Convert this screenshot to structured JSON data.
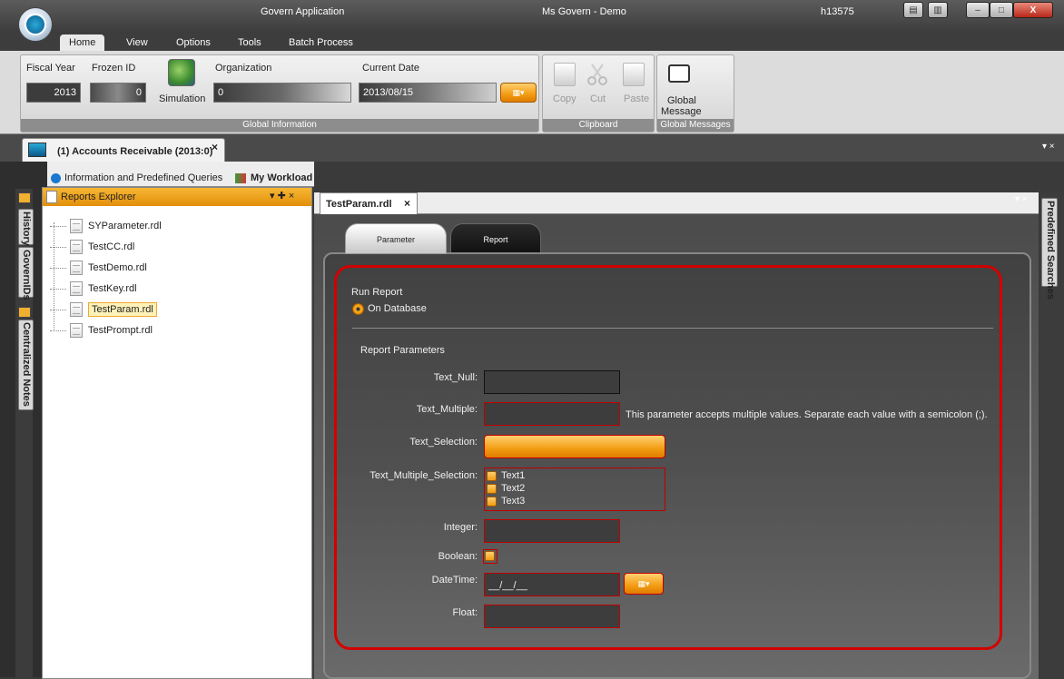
{
  "titlebar": {
    "app_name": "Govern Application",
    "window_title": "Ms Govern - Demo",
    "user": "h13575",
    "close_label": "X"
  },
  "ribbon_tabs": [
    "Home",
    "View",
    "Options",
    "Tools",
    "Batch Process"
  ],
  "global_info": {
    "fiscal_year_label": "Fiscal Year",
    "fiscal_year_value": "2013",
    "frozen_id_label": "Frozen ID",
    "frozen_id_value": "0",
    "simulation_label": "Simulation",
    "organization_label": "Organization",
    "organization_value": "0",
    "current_date_label": "Current Date",
    "current_date_value": "2013/08/15",
    "footer": "Global Information"
  },
  "clipboard": {
    "copy": "Copy",
    "cut": "Cut",
    "paste": "Paste",
    "footer": "Clipboard"
  },
  "global_messages": {
    "button_line1": "Global",
    "button_line2": "Message",
    "footer": "Global Messages"
  },
  "document_tab": {
    "label": "(1) Accounts Receivable (2013:0)",
    "close": "×"
  },
  "sub_tabs": {
    "info": "Information and Predefined Queries",
    "workload": "My Workload"
  },
  "left_rail": [
    "History",
    "GovernIDs",
    "Centralized Notes"
  ],
  "explorer": {
    "title": "Reports Explorer",
    "items": [
      "SYParameter.rdl",
      "TestCC.rdl",
      "TestDemo.rdl",
      "TestKey.rdl",
      "TestParam.rdl",
      "TestPrompt.rdl"
    ]
  },
  "report_tab": {
    "label": "TestParam.rdl",
    "close": "×"
  },
  "param_tabs": {
    "parameter": "Parameter",
    "report": "Report"
  },
  "form": {
    "run_report": "Run Report",
    "on_database": "On Database",
    "report_parameters": "Report Parameters",
    "text_null": "Text_Null:",
    "text_multiple": "Text_Multiple:",
    "multiple_hint": "This parameter accepts multiple values. Separate each value with a semicolon (;).",
    "text_selection": "Text_Selection:",
    "text_multiple_selection": "Text_Multiple_Selection:",
    "options": [
      "Text1",
      "Text2",
      "Text3"
    ],
    "integer": "Integer:",
    "boolean": "Boolean:",
    "datetime": "DateTime:",
    "datetime_value": "__/__/__",
    "float": "Float:"
  },
  "right_rail": "Predefined Searches"
}
